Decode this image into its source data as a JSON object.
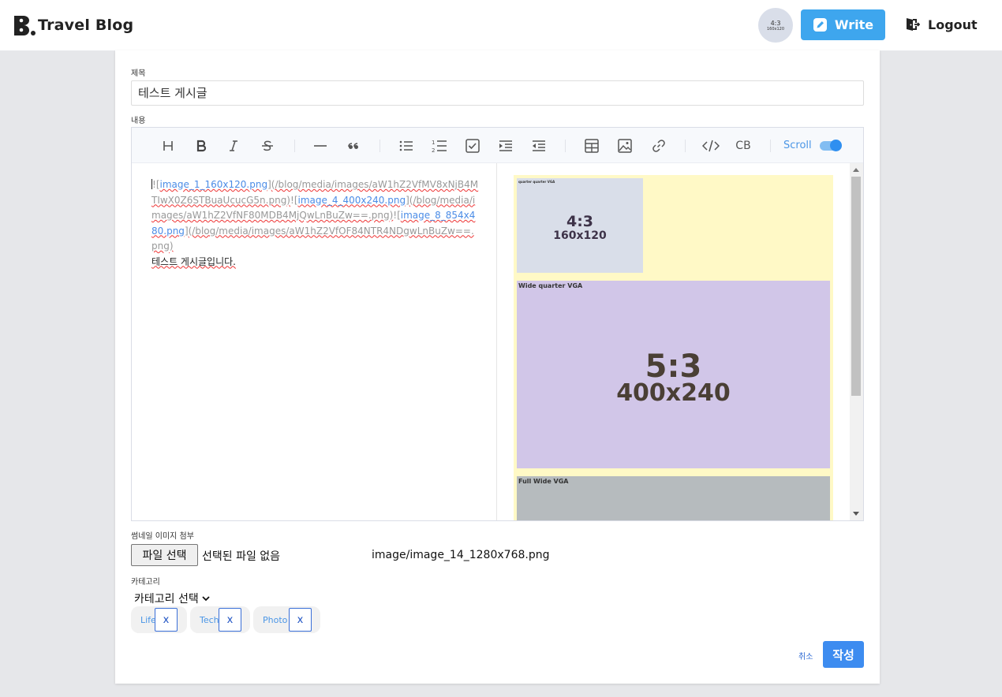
{
  "header": {
    "brand": "Travel Blog",
    "avatar_line1": "4:3",
    "avatar_line2": "160x120",
    "write_label": "Write",
    "logout_label": "Logout"
  },
  "form": {
    "title_label": "제목",
    "title_value": "테스트 게시글",
    "content_label": "내용",
    "thumbnail_label": "썸네일 이미지 첨부",
    "file_button_label": "파일 선택",
    "file_none_text": "선택된 파일 없음",
    "file_path": "image/image_14_1280x768.png",
    "category_label": "카테고리",
    "category_select_value": "카테고리 선택",
    "tags": [
      "Life",
      "Tech",
      "Photo"
    ],
    "tag_remove_label": "x",
    "cancel_label": "취소",
    "submit_label": "작성"
  },
  "editor": {
    "toolbar": {
      "icons": [
        "heading-icon",
        "bold-icon",
        "italic-icon",
        "strike-icon",
        "hr-icon",
        "quote-icon",
        "bullet-list-icon",
        "ordered-list-icon",
        "task-list-icon",
        "indent-icon",
        "outdent-icon",
        "table-icon",
        "image-icon",
        "link-icon",
        "code-icon",
        "codeblock-icon"
      ],
      "codeblock_label": "CB",
      "scroll_label": "Scroll",
      "scroll_sync_on": true
    },
    "markdown": {
      "img1_label": "image_1_160x120.png",
      "img1_url": "(/blog/media/images/aW1hZ2VfMV8xNjB4MTIwX0Z6STBuaUcucG5n.png)",
      "img2_label": "image_4_400x240.png",
      "img2_url": "(/blog/media/images/aW1hZ2VfNF80MDB4MjQwLnBuZw==.png)",
      "img3_label": "image_8_854x480.png",
      "img3_url": "(/blog/media/images/aW1hZ2VfOF84NTR4NDgwLnBuZw==.png)",
      "body_text": "테스트 게시글입니다."
    },
    "preview": {
      "img1_caption": "quarter quarter VGA",
      "img1_ratio": "4:3",
      "img1_size": "160x120",
      "img2_caption": "Wide quarter VGA",
      "img2_ratio": "5:3",
      "img2_size": "400x240",
      "img3_caption": "Full Wide VGA"
    }
  },
  "colors": {
    "accent": "#3ea6ee",
    "submit": "#3d8cf0",
    "page_bg": "#e6e7ea",
    "preview_bg": "#fff9c6",
    "img1_bg": "#d9dee9",
    "img2_bg": "#d1c6e8",
    "img3_bg": "#b6bbbe"
  }
}
